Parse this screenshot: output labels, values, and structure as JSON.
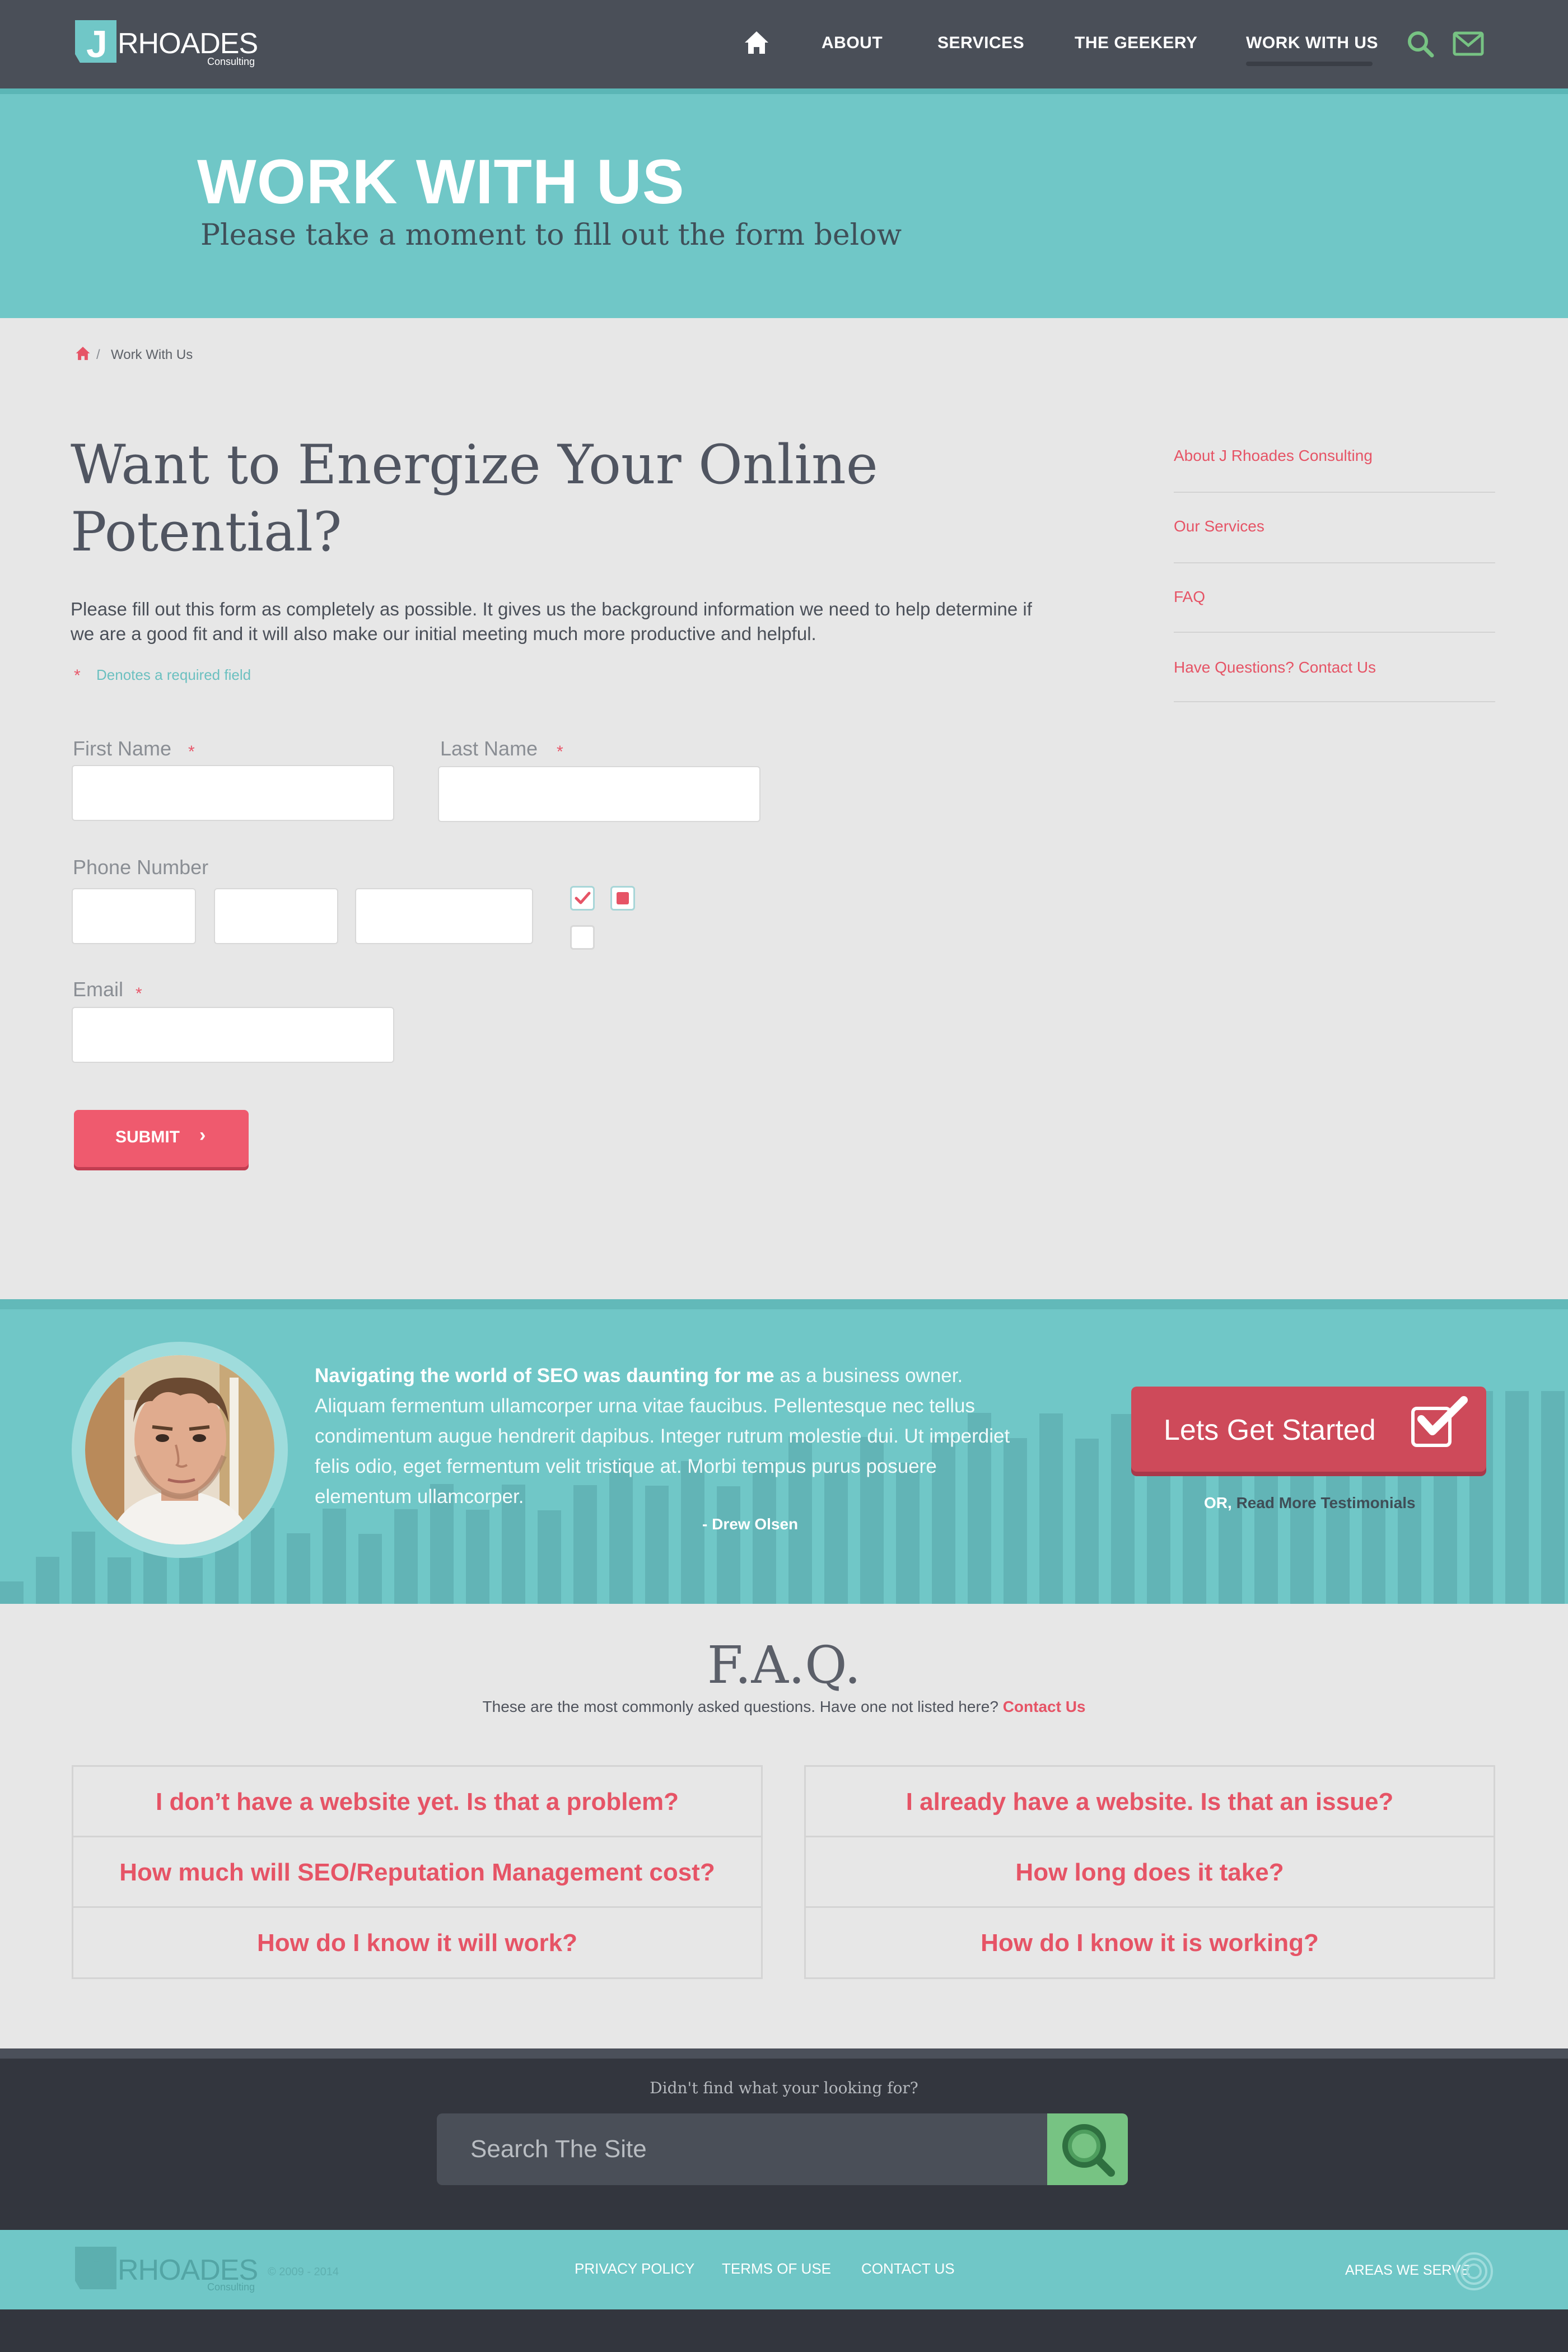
{
  "header": {
    "logo_letter": "J",
    "logo_name": "RHOADES",
    "logo_tagline": "Consulting",
    "nav": [
      "ABOUT",
      "SERVICES",
      "THE GEEKERY",
      "WORK WITH US"
    ]
  },
  "hero": {
    "title": "WORK WITH US",
    "subtitle": "Please take a moment to fill out the form below"
  },
  "breadcrumb": {
    "current": "Work With Us"
  },
  "form": {
    "heading": "Want to Energize Your Online Potential?",
    "intro": "Please fill out this form as completely as possible. It gives us the background information we need to help determine if we are a good fit and it will also make our initial meeting much more productive and helpful.",
    "required_note": "Denotes a required field",
    "first_name_label": "First Name",
    "last_name_label": "Last Name",
    "phone_label": "Phone Number",
    "email_label": "Email",
    "submit_label": "SUBMIT"
  },
  "sidebar": {
    "links": [
      "About J Rhoades Consulting",
      "Our Services",
      "FAQ",
      "Have Questions? Contact Us"
    ]
  },
  "testimonial": {
    "lead": "Navigating the world of SEO was daunting for me",
    "body": " as a business owner. Aliquam fermentum ullamcorper urna vitae faucibus. Pellentesque nec tellus condimentum augue hendrerit dapibus. Integer rutrum molestie dui. Ut imperdiet felis odio, eget fermentum velit tristique at. Morbi tempus purus posuere elementum ullamcorper.",
    "author": "- Drew Olsen",
    "cta_label": "Lets Get Started",
    "or_label": "OR,",
    "more_link": "Read More Testimonials"
  },
  "faq": {
    "title": "F.A.Q.",
    "subtitle": "These are the most commonly asked questions. Have one not listed here?",
    "subtitle_link": "Contact Us",
    "left": [
      "I don’t have a website yet. Is that a problem?",
      "How much will SEO/Reputation Management cost?",
      "How do I know it will work?"
    ],
    "right": [
      "I already have a website. Is that an issue?",
      "How long does it take?",
      "How do I know it is working?"
    ]
  },
  "search_footer": {
    "prompt": "Didn't find what your looking for?",
    "placeholder": "Search The Site"
  },
  "footer": {
    "copyright": "© 2009 - 2014",
    "links": [
      "PRIVACY POLICY",
      "TERMS OF USE",
      "CONTACT US"
    ],
    "areas_label": "AREAS WE SERVE"
  },
  "colors": {
    "teal": "#70c7c7",
    "coral": "#e65466",
    "dark": "#4a4f58",
    "green": "#77c383"
  },
  "icons": [
    "home-icon",
    "search-icon",
    "mail-icon",
    "checkmark-icon",
    "chevron-right-icon",
    "target-icon"
  ]
}
